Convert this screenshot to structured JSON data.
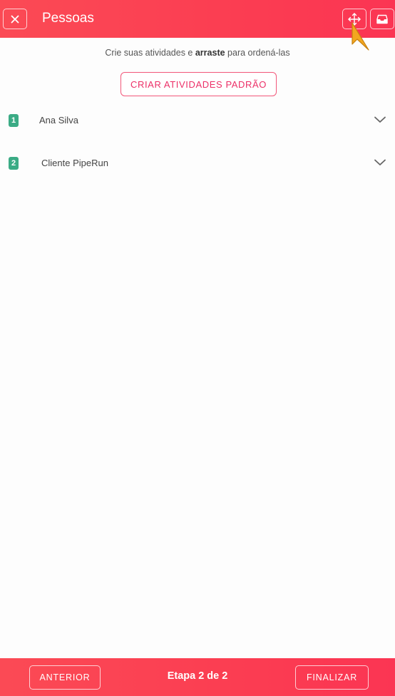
{
  "header": {
    "title": "Pessoas",
    "close_icon": "close-icon",
    "move_icon": "move-icon",
    "inbox_icon": "inbox-icon"
  },
  "content": {
    "hint_before": "Crie suas atividades e ",
    "hint_bold": "arraste",
    "hint_after": " para ordená-las",
    "create_button_label": "CRIAR ATIVIDADES PADRÃO",
    "items": [
      {
        "number": "1",
        "label": "Ana Silva"
      },
      {
        "number": "2",
        "label": "Cliente PipeRun"
      }
    ]
  },
  "footer": {
    "previous_label": "ANTERIOR",
    "step_label": "Etapa 2 de 2",
    "finish_label": "FINALIZAR"
  },
  "colors": {
    "brand_red": "#fb3d52",
    "accent_pink": "#ec2f67",
    "badge_green": "#3bab85"
  }
}
